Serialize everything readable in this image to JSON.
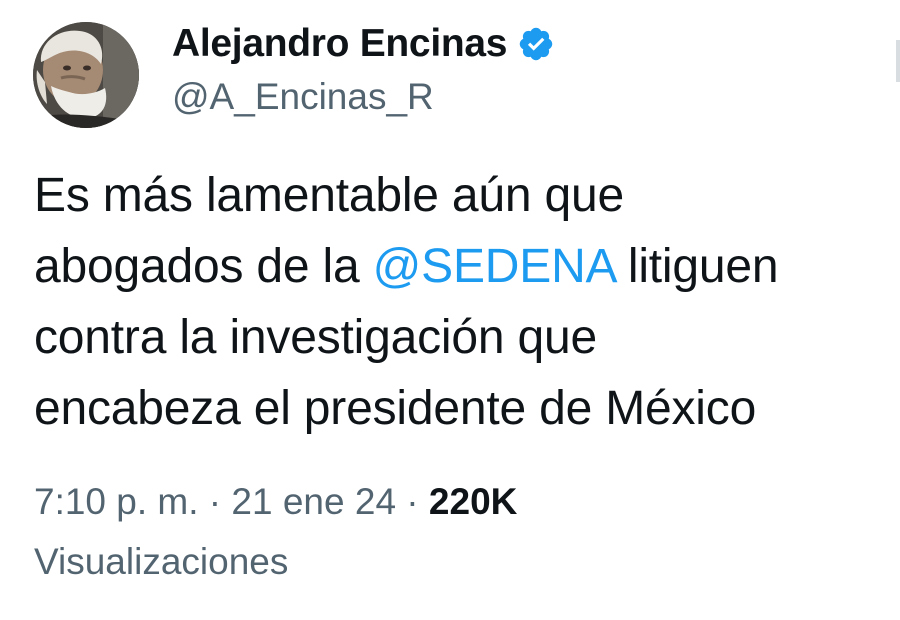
{
  "author": {
    "display_name": "Alejandro Encinas",
    "handle": "@A_Encinas_R",
    "verified": true,
    "avatar_icon": "profile-photo-gray-haired-bearded-man",
    "verified_color": "#1d9bf0"
  },
  "tweet": {
    "line1": "Es más lamentable aún que",
    "line2_before": "abogados de la ",
    "line2_mention": "@SEDENA",
    "line2_after": " litiguen",
    "line3": "contra la investigación que",
    "line4": "encabeza el presidente de México"
  },
  "meta": {
    "time": "7:10 p. m.",
    "separator": " · ",
    "date": "21 ene 24",
    "views_count": "220K",
    "views_label": "Visualizaciones"
  },
  "colors": {
    "text": "#0f1419",
    "secondary": "#536471",
    "accent": "#1d9bf0"
  }
}
